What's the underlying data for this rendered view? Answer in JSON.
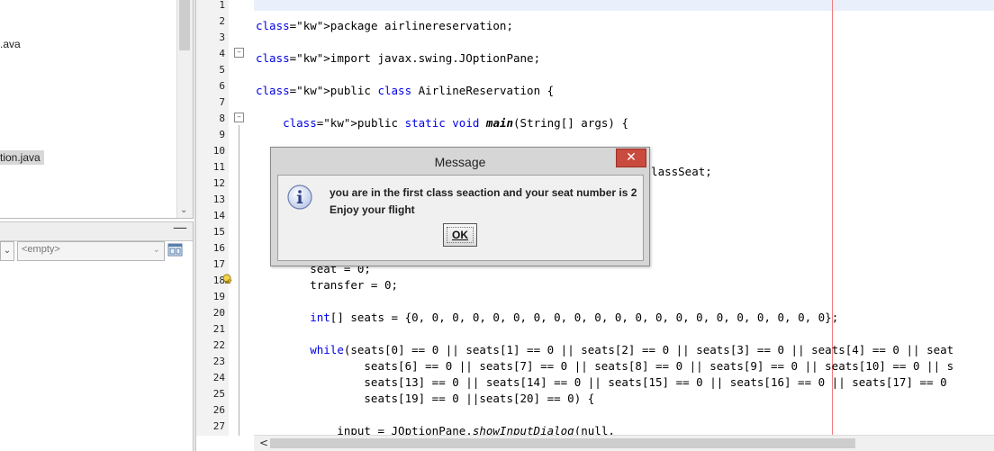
{
  "left_panel": {
    "tree_items": [
      ".ava",
      "tion.java"
    ],
    "navigator_combo_value": "<empty>"
  },
  "editor": {
    "line_numbers": [
      "1",
      "2",
      "3",
      "4",
      "5",
      "6",
      "7",
      "8",
      "9",
      "10",
      "11",
      "12",
      "13",
      "14",
      "15",
      "16",
      "17",
      "18",
      "19",
      "20",
      "21",
      "22",
      "23",
      "24",
      "25",
      "26",
      "27"
    ],
    "code_lines": [
      {
        "n": "2",
        "text": "package airlinereservation;"
      },
      {
        "n": "4",
        "text": "import javax.swing.JOptionPane;"
      },
      {
        "n": "6",
        "text": "public class AirlineReservation {"
      },
      {
        "n": "8",
        "text": "    public static void main(String[] args) {"
      },
      {
        "n": "11",
        "text": "nClassSeat;"
      },
      {
        "n": "17",
        "text": "        seat = 0;"
      },
      {
        "n": "18",
        "text": "        transfer = 0;"
      },
      {
        "n": "20",
        "text": "        int[] seats = {0, 0, 0, 0, 0, 0, 0, 0, 0, 0, 0, 0, 0, 0, 0, 0, 0, 0, 0, 0, 0};"
      },
      {
        "n": "22",
        "text": "        while(seats[0] == 0 || seats[1] == 0 || seats[2] == 0 || seats[3] == 0 || seats[4] == 0 || seat"
      },
      {
        "n": "23",
        "text": "                seats[6] == 0 || seats[7] == 0 || seats[8] == 0 || seats[9] == 0 || seats[10] == 0 || s"
      },
      {
        "n": "24",
        "text": "                seats[13] == 0 || seats[14] == 0 || seats[15] == 0 || seats[16] == 0 || seats[17] == 0"
      },
      {
        "n": "25",
        "text": "                seats[19] == 0 ||seats[20] == 0) {"
      },
      {
        "n": "27",
        "text": "            input = JOptionPane.showInputDialog(null,"
      }
    ]
  },
  "dialog": {
    "title": "Message",
    "close_symbol": "✕",
    "line1": "you are in the first class seaction and your seat number is 2",
    "line2": "Enjoy your flight",
    "ok_label": "OK"
  }
}
